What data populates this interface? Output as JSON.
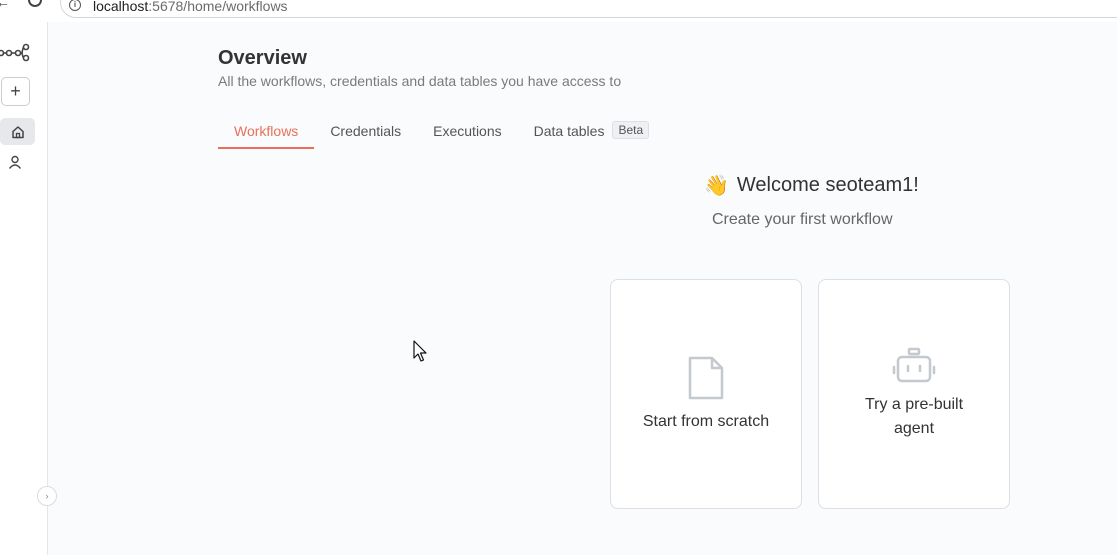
{
  "browser": {
    "url_host": "localhost",
    "url_path": ":5678/home/workflows"
  },
  "sidebar": {
    "items": [
      {
        "name": "logo",
        "icon": "workflow-nodes-icon"
      },
      {
        "name": "add",
        "icon": "plus-icon",
        "label": "+"
      },
      {
        "name": "home",
        "icon": "home-icon"
      },
      {
        "name": "user",
        "icon": "user-icon"
      }
    ],
    "collapse_icon": "›"
  },
  "header": {
    "title": "Overview",
    "subtitle": "All the workflows, credentials and data tables you have access to"
  },
  "tabs": [
    {
      "label": "Workflows",
      "active": true
    },
    {
      "label": "Credentials",
      "active": false
    },
    {
      "label": "Executions",
      "active": false
    },
    {
      "label": "Data tables",
      "active": false,
      "badge": "Beta"
    }
  ],
  "welcome": {
    "emoji": "👋",
    "title": "Welcome seoteam1!",
    "subtitle": "Create your first workflow"
  },
  "cards": [
    {
      "label": "Start from scratch",
      "icon": "file-icon"
    },
    {
      "label": "Try a pre-built agent",
      "icon": "robot-icon"
    }
  ],
  "colors": {
    "accent": "#e8705a",
    "background": "#fafbfc",
    "border": "#dcdfe4"
  }
}
